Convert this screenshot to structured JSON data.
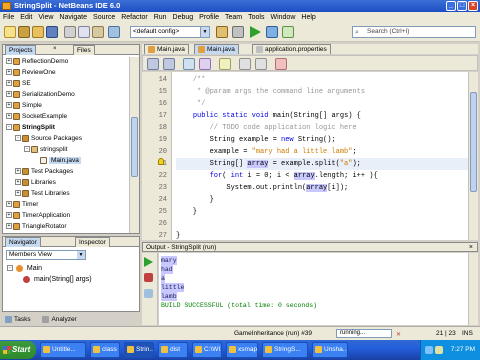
{
  "window": {
    "title": "StringSplit - NetBeans IDE 6.0"
  },
  "menu": [
    "File",
    "Edit",
    "View",
    "Navigate",
    "Source",
    "Refactor",
    "Run",
    "Debug",
    "Profile",
    "Team",
    "Tools",
    "Window",
    "Help"
  ],
  "toolbar": {
    "config": "<default config>",
    "search_placeholder": "Search (Ctrl+I)"
  },
  "projects_panel": {
    "tabs": [
      "Projects",
      "Files"
    ],
    "items": [
      {
        "label": "ReflectionDemo",
        "depth": 0,
        "expanded": false,
        "bold": false
      },
      {
        "label": "ReviewOne",
        "depth": 0,
        "expanded": false,
        "bold": false
      },
      {
        "label": "SE",
        "depth": 0,
        "expanded": false,
        "bold": false
      },
      {
        "label": "SerializationDemo",
        "depth": 0,
        "expanded": false,
        "bold": false
      },
      {
        "label": "Simple",
        "depth": 0,
        "expanded": false,
        "bold": false
      },
      {
        "label": "SocketExample",
        "depth": 0,
        "expanded": false,
        "bold": false
      },
      {
        "label": "StringSplit",
        "depth": 0,
        "expanded": true,
        "bold": true
      },
      {
        "label": "Source Packages",
        "depth": 1,
        "expanded": true,
        "bold": false
      },
      {
        "label": "stringsplit",
        "depth": 2,
        "expanded": true,
        "bold": false
      },
      {
        "label": "Main.java",
        "depth": 3,
        "expanded": false,
        "bold": false,
        "selected": true
      },
      {
        "label": "Test Packages",
        "depth": 1,
        "expanded": false,
        "bold": false
      },
      {
        "label": "Libraries",
        "depth": 1,
        "expanded": false,
        "bold": false
      },
      {
        "label": "Test Libraries",
        "depth": 1,
        "expanded": false,
        "bold": false
      },
      {
        "label": "Timer",
        "depth": 0,
        "expanded": false,
        "bold": false
      },
      {
        "label": "TimerApplication",
        "depth": 0,
        "expanded": false,
        "bold": false
      },
      {
        "label": "TriangleRotator",
        "depth": 0,
        "expanded": false,
        "bold": false
      }
    ]
  },
  "navigator": {
    "tabs": [
      "Navigator",
      "Inspector"
    ],
    "view": "Members View",
    "items": [
      "Main",
      "main(String[] args)"
    ]
  },
  "editor": {
    "tabs": [
      "Main.java",
      "Main.java",
      "application.properties"
    ],
    "lines": [
      {
        "n": "14",
        "text": "    /**",
        "style": "cmt"
      },
      {
        "n": "15",
        "text": "     * @param args the command line arguments",
        "style": "cmt"
      },
      {
        "n": "16",
        "text": "     */",
        "style": "cmt"
      },
      {
        "n": "17",
        "text": "    public static void main(String[] args) {",
        "style": "code"
      },
      {
        "n": "18",
        "text": "        // TODO code application logic here",
        "style": "cmt"
      },
      {
        "n": "19",
        "text": "        String example = new String();",
        "style": "code"
      },
      {
        "n": "20",
        "text": "        example = \"mary had a little lamb\";",
        "style": "code"
      },
      {
        "n": "21",
        "text": "        String[] array = example.split(\"a\");",
        "style": "code"
      },
      {
        "n": "22",
        "text": "        for( int i = 0; i < array.length; i++ ){",
        "style": "code"
      },
      {
        "n": "23",
        "text": "            System.out.println(array[i]);",
        "style": "code"
      },
      {
        "n": "24",
        "text": "        }",
        "style": "code"
      },
      {
        "n": "25",
        "text": "    }",
        "style": "code"
      },
      {
        "n": "26",
        "text": "",
        "style": "code"
      },
      {
        "n": "27",
        "text": "}",
        "style": "code"
      }
    ]
  },
  "output": {
    "title": "Output - StringSplit (run)",
    "lines": [
      "mary",
      "had",
      "a",
      "little",
      "lamb",
      "BUILD SUCCESSFUL (total time: 0 seconds)"
    ]
  },
  "bottom_tabs": [
    "Tasks",
    "Analyzer"
  ],
  "status": {
    "task": "GameInheritance (run) #39",
    "progress_text": "running...",
    "caret": "21 | 23",
    "mode": "INS"
  },
  "taskbar": {
    "start": "Start",
    "buttons": [
      "Untitle...",
      "class p...",
      "Strin...",
      "dist",
      "C:\\WI...",
      "xsmap...",
      "StringS...",
      "Unsha..."
    ],
    "clock": "7:27 PM"
  }
}
